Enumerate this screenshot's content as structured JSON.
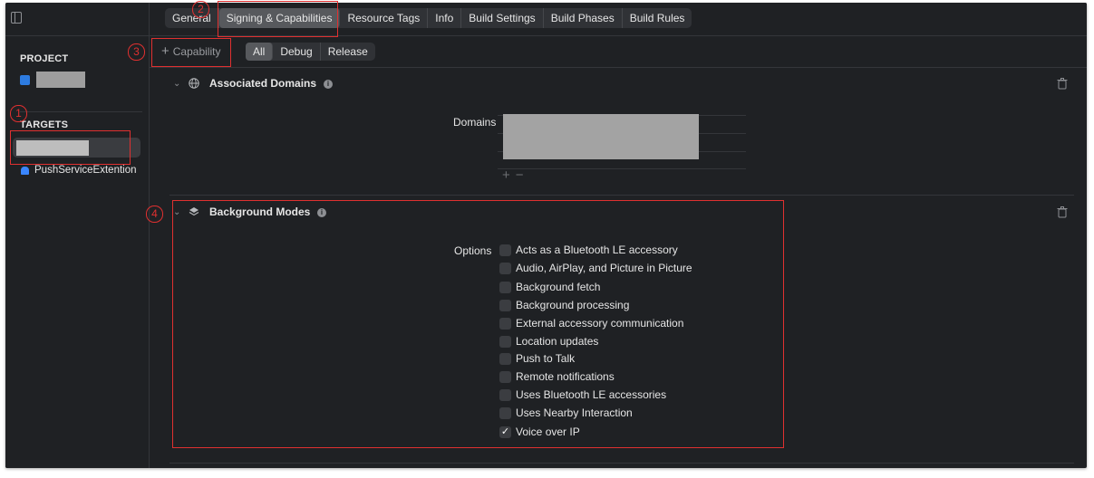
{
  "toolbar": {
    "tabs": [
      {
        "label": "General"
      },
      {
        "label": "Signing & Capabilities"
      },
      {
        "label": "Resource Tags"
      },
      {
        "label": "Info"
      },
      {
        "label": "Build Settings"
      },
      {
        "label": "Build Phases"
      },
      {
        "label": "Build Rules"
      }
    ],
    "active_tab": "Signing & Capabilities"
  },
  "sidebar": {
    "project_header": "PROJECT",
    "targets_header": "TARGETS",
    "target_extension": "PushServiceExtention"
  },
  "capability_bar": {
    "add_label": "Capability",
    "filters": [
      "All",
      "Debug",
      "Release"
    ],
    "active_filter": "All"
  },
  "associated_domains": {
    "title": "Associated Domains",
    "field_label": "Domains"
  },
  "background_modes": {
    "title": "Background Modes",
    "field_label": "Options",
    "options": [
      {
        "label": "Acts as a Bluetooth LE accessory",
        "checked": false
      },
      {
        "label": "Audio, AirPlay, and Picture in Picture",
        "checked": false
      },
      {
        "label": "Background fetch",
        "checked": false
      },
      {
        "label": "Background processing",
        "checked": false
      },
      {
        "label": "External accessory communication",
        "checked": false
      },
      {
        "label": "Location updates",
        "checked": false
      },
      {
        "label": "Push to Talk",
        "checked": false
      },
      {
        "label": "Remote notifications",
        "checked": false
      },
      {
        "label": "Uses Bluetooth LE accessories",
        "checked": false
      },
      {
        "label": "Uses Nearby Interaction",
        "checked": false
      },
      {
        "label": "Voice over IP",
        "checked": true
      }
    ]
  },
  "annotations": [
    "1",
    "2",
    "3",
    "4"
  ],
  "colors": {
    "annotation": "#e03030",
    "accent": "#2d7be0",
    "background": "#1f2124"
  }
}
